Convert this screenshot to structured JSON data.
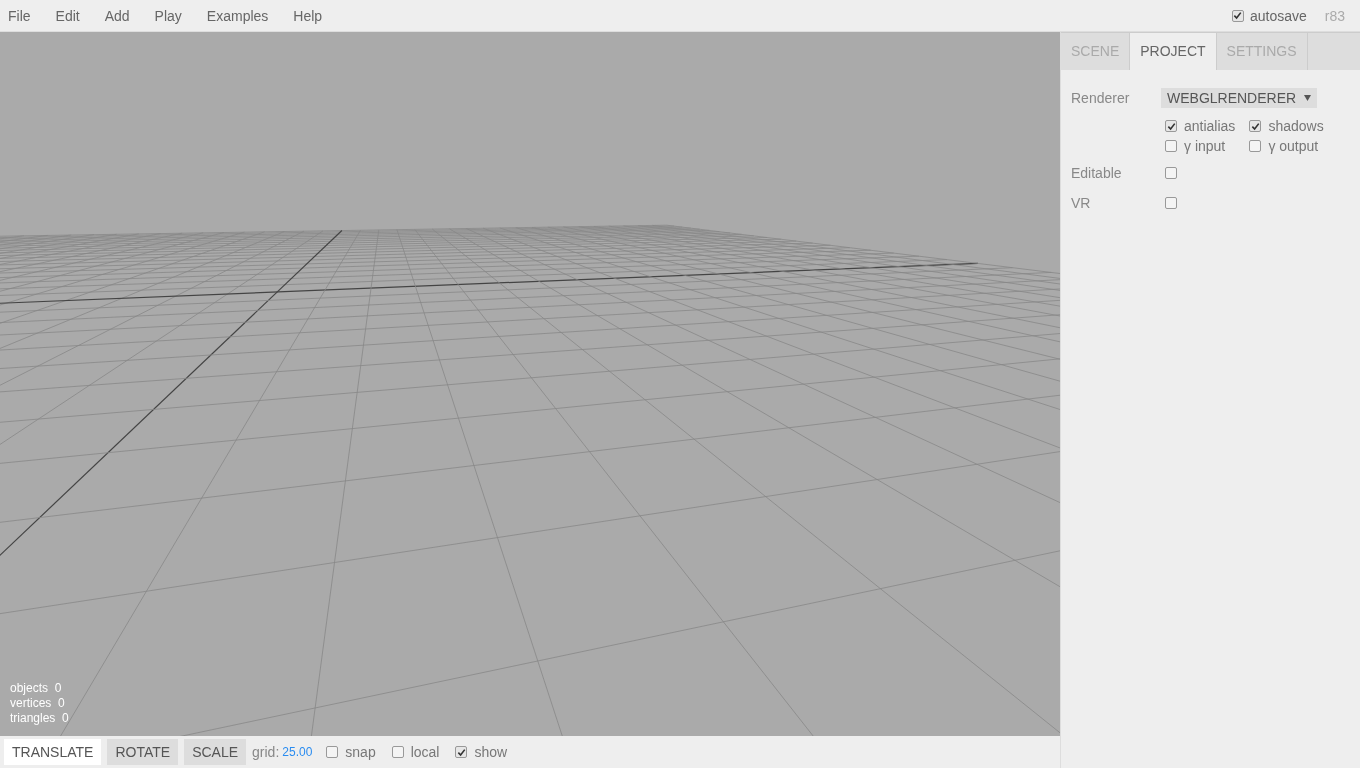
{
  "menubar": {
    "menus": [
      "File",
      "Edit",
      "Add",
      "Play",
      "Examples",
      "Help"
    ],
    "autosave": {
      "label": "autosave",
      "checked": true
    },
    "revision": "r83"
  },
  "viewport": {
    "info": [
      {
        "label": "objects",
        "value": "0"
      },
      {
        "label": "vertices",
        "value": "0"
      },
      {
        "label": "triangles",
        "value": "0"
      }
    ]
  },
  "toolbar": {
    "buttons": [
      {
        "label": "TRANSLATE",
        "selected": true
      },
      {
        "label": "ROTATE",
        "selected": false
      },
      {
        "label": "SCALE",
        "selected": false
      }
    ],
    "grid_label": "grid:",
    "grid_value": "25.00",
    "options": [
      {
        "label": "snap",
        "checked": false
      },
      {
        "label": "local",
        "checked": false
      },
      {
        "label": "show",
        "checked": true
      }
    ]
  },
  "sidebar": {
    "tabs": [
      {
        "label": "SCENE",
        "selected": false
      },
      {
        "label": "PROJECT",
        "selected": true
      },
      {
        "label": "SETTINGS",
        "selected": false
      }
    ],
    "renderer": {
      "label": "Renderer",
      "value": "WEBGLRENDERER",
      "options": [
        {
          "label": "antialias",
          "checked": true
        },
        {
          "label": "shadows",
          "checked": true
        },
        {
          "label": "γ input",
          "checked": false
        },
        {
          "label": "γ output",
          "checked": false
        }
      ]
    },
    "rows": [
      {
        "label": "Editable",
        "checked": false
      },
      {
        "label": "VR",
        "checked": false
      }
    ]
  }
}
